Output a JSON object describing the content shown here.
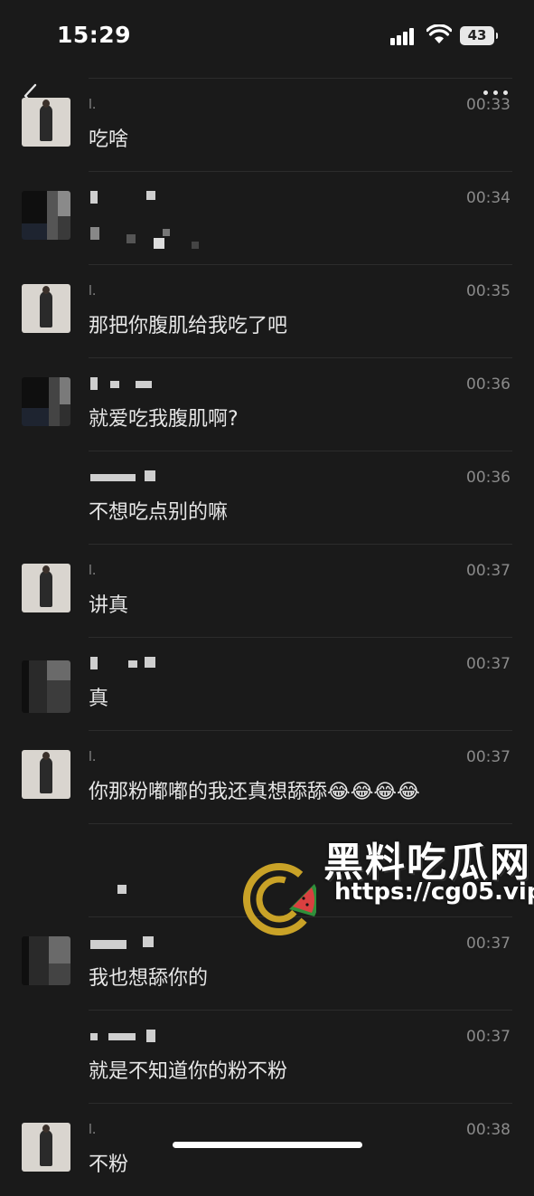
{
  "status_bar": {
    "time": "15:29",
    "battery": "43"
  },
  "messages": [
    {
      "sender": "l.",
      "time": "00:33",
      "text": "吃啥",
      "avatar": "photo"
    },
    {
      "sender": "",
      "time": "00:34",
      "text": "",
      "avatar": "pixelated"
    },
    {
      "sender": "l.",
      "time": "00:35",
      "text": "那把你腹肌给我吃了吧",
      "avatar": "photo"
    },
    {
      "sender": "",
      "time": "00:36",
      "text": "就爱吃我腹肌啊?",
      "avatar": "pixelated"
    },
    {
      "sender": "",
      "time": "00:36",
      "text": "不想吃点别的嘛",
      "avatar": "none"
    },
    {
      "sender": "l.",
      "time": "00:37",
      "text": "讲真",
      "avatar": "photo"
    },
    {
      "sender": "",
      "time": "00:37",
      "text": "真",
      "avatar": "pixelated"
    },
    {
      "sender": "l.",
      "time": "00:37",
      "text": "你那粉嘟嘟的我还真想舔舔😂😂😂😂",
      "avatar": "photo"
    },
    {
      "sender": "",
      "time": "",
      "text": "",
      "avatar": "none"
    },
    {
      "sender": "",
      "time": "00:37",
      "text": "我也想舔你的",
      "avatar": "pixelated"
    },
    {
      "sender": "",
      "time": "00:37",
      "text": "就是不知道你的粉不粉",
      "avatar": "none"
    },
    {
      "sender": "l.",
      "time": "00:38",
      "text": "不粉",
      "avatar": "photo"
    }
  ],
  "watermark": {
    "title": "黑料吃瓜网",
    "url": "https://cg05.vip"
  },
  "icons": {
    "back": "chevron-left-icon",
    "more": "more-dots-icon"
  }
}
